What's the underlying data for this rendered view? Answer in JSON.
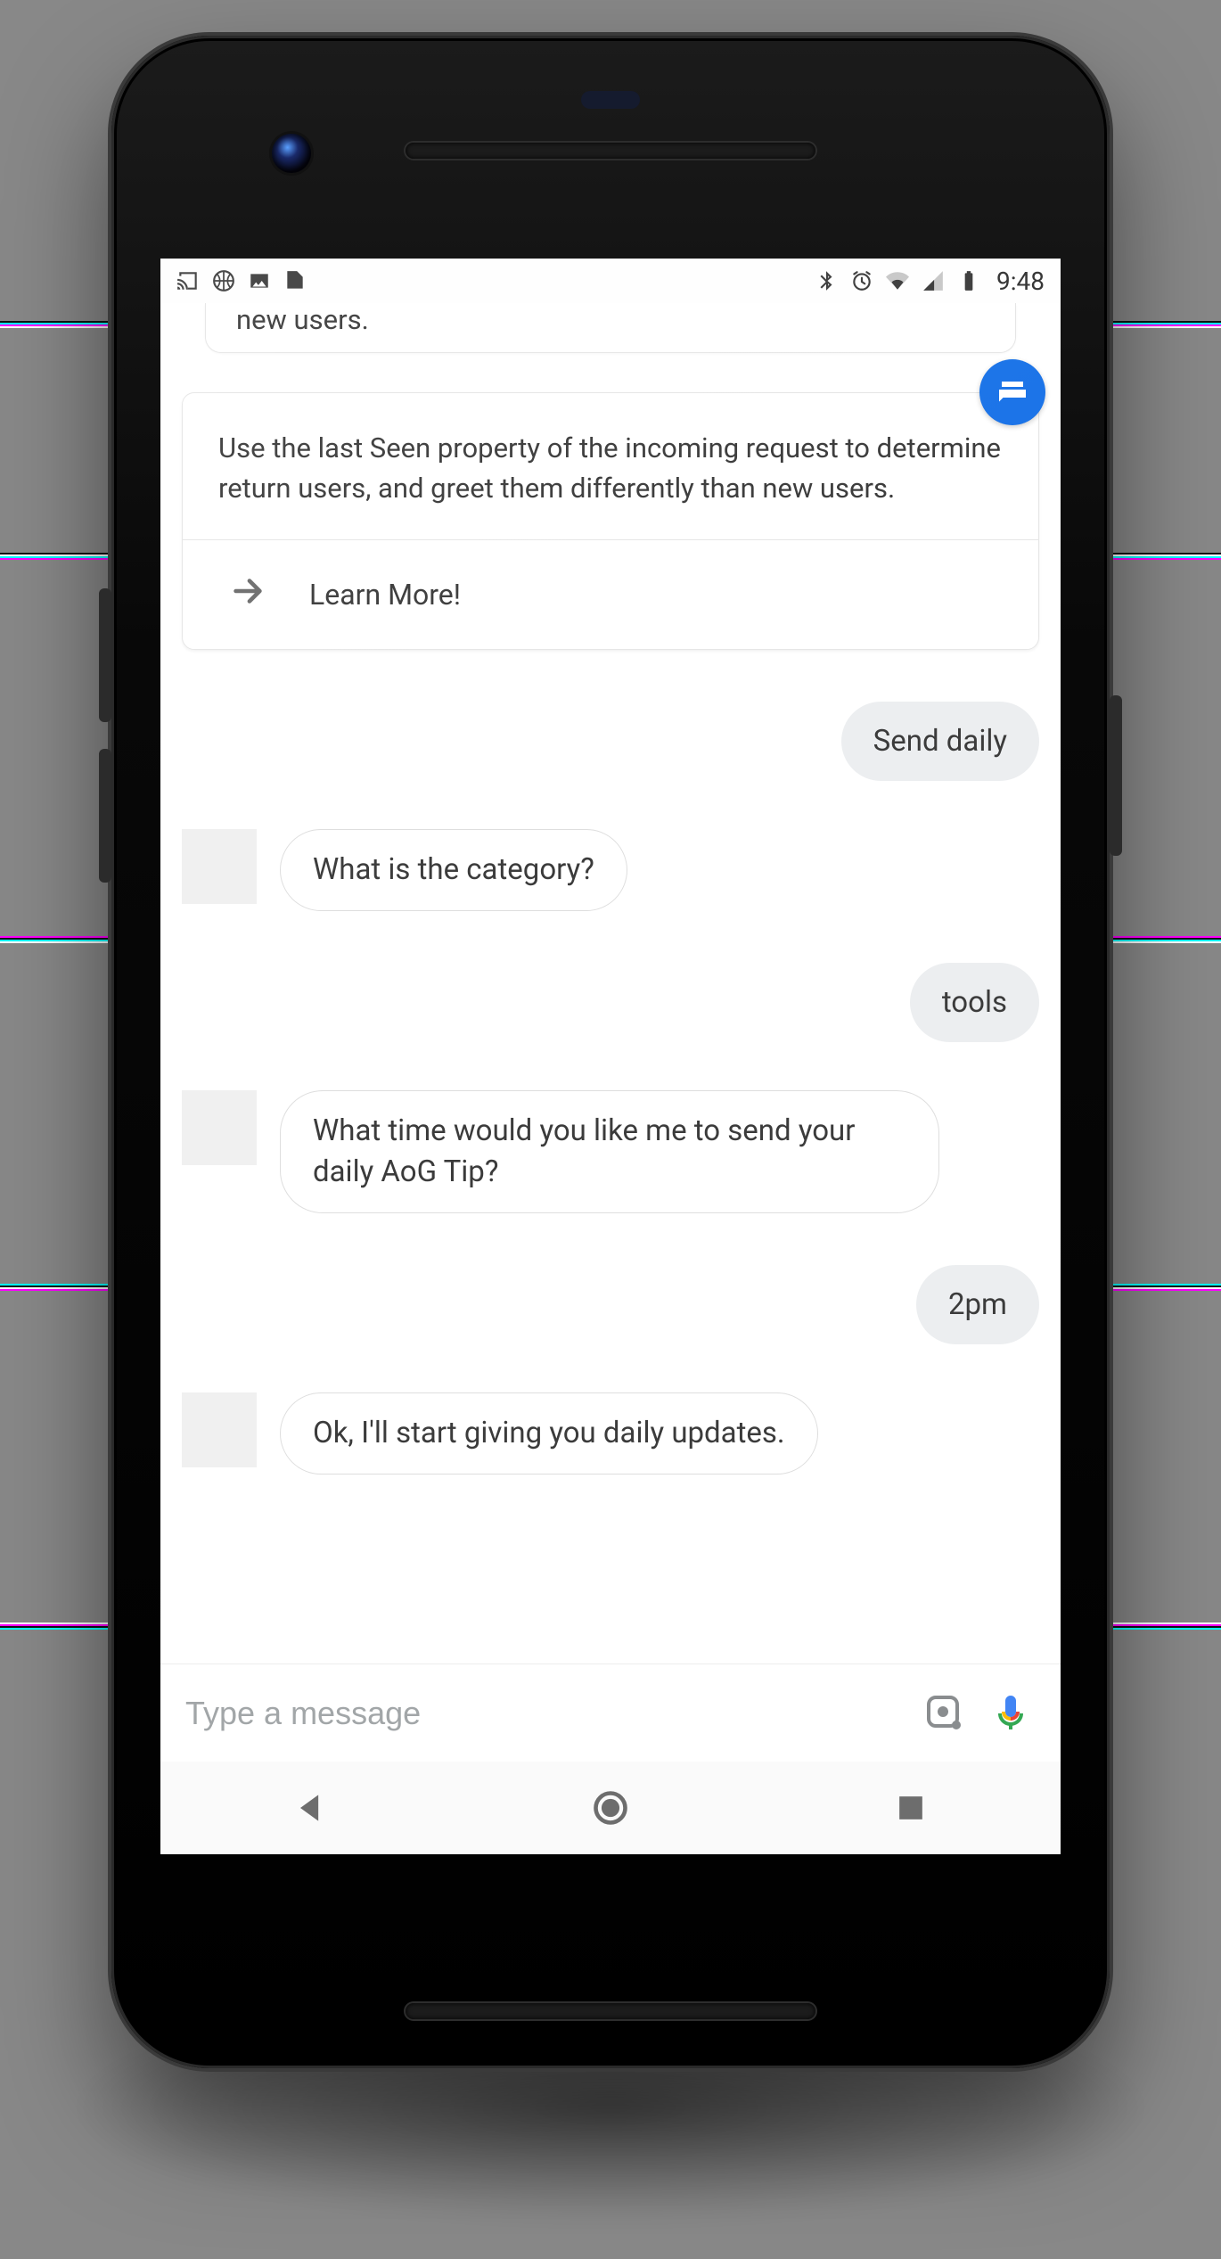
{
  "status": {
    "time": "9:48",
    "left_icons": [
      "cast-icon",
      "basketball-icon",
      "photo-icon",
      "check-doc-icon"
    ],
    "right_icons": [
      "bluetooth-icon",
      "alarm-icon",
      "wifi-icon",
      "cell-icon",
      "battery-icon"
    ]
  },
  "card_partial_text": "new users.",
  "card": {
    "body": "Use the last Seen property of the incoming request to determine return users, and greet them differently than new users.",
    "action_label": "Learn More!"
  },
  "messages": {
    "u1": "Send daily",
    "b1": "What is the category?",
    "u2": "tools",
    "b2": "What time would you like me to send your daily AoG Tip?",
    "u3": "2pm",
    "b3": "Ok, I'll start giving you daily updates."
  },
  "input": {
    "placeholder": "Type a message"
  },
  "colors": {
    "accent": "#1a73e8",
    "bubble_user_bg": "#eceef0",
    "border": "#e6e6e6"
  }
}
